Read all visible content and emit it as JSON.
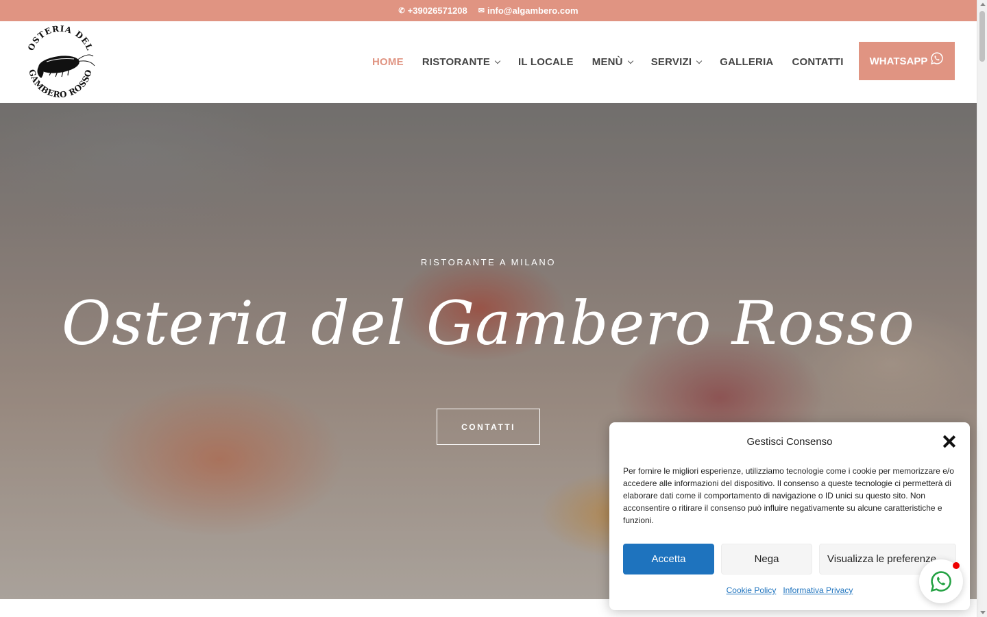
{
  "theme": {
    "accent": "#e09482",
    "consent_button": "#1e73be"
  },
  "topbar": {
    "phone": "+39026571208",
    "phone_icon": "phone-icon",
    "email": "info@algambero.com",
    "email_icon": "envelope-icon"
  },
  "header": {
    "logo_text_top": "OSTERIA DEL",
    "logo_text_bottom": "GAMBERO ROSSO",
    "logo_icon": "shrimp-icon",
    "nav": [
      {
        "label": "HOME",
        "active": true,
        "dropdown": false
      },
      {
        "label": "RISTORANTE",
        "active": false,
        "dropdown": true
      },
      {
        "label": "IL LOCALE",
        "active": false,
        "dropdown": false
      },
      {
        "label": "MENÙ",
        "active": false,
        "dropdown": true
      },
      {
        "label": "SERVIZI",
        "active": false,
        "dropdown": true
      },
      {
        "label": "GALLERIA",
        "active": false,
        "dropdown": false
      },
      {
        "label": "CONTATTI",
        "active": false,
        "dropdown": false
      }
    ],
    "whatsapp_label": "WHATSAPP",
    "whatsapp_icon": "whatsapp-icon"
  },
  "hero": {
    "subtitle": "RISTORANTE A MILANO",
    "title": "Osteria del Gambero Rosso",
    "button": "CONTATTI"
  },
  "consent": {
    "title": "Gestisci Consenso",
    "close_icon": "close-icon",
    "text": "Per fornire le migliori esperienze, utilizziamo tecnologie come i cookie per memorizzare e/o accedere alle informazioni del dispositivo. Il consenso a queste tecnologie ci permetterà di elaborare dati come il comportamento di navigazione o ID unici su questo sito. Non acconsentire o ritirare il consenso può influire negativamente su alcune caratteristiche e funzioni.",
    "accept": "Accetta",
    "deny": "Nega",
    "preferences": "Visualizza le preferenze",
    "cookie_policy": "Cookie Policy",
    "privacy": "Informativa Privacy"
  },
  "floating": {
    "icon": "whatsapp-icon"
  }
}
